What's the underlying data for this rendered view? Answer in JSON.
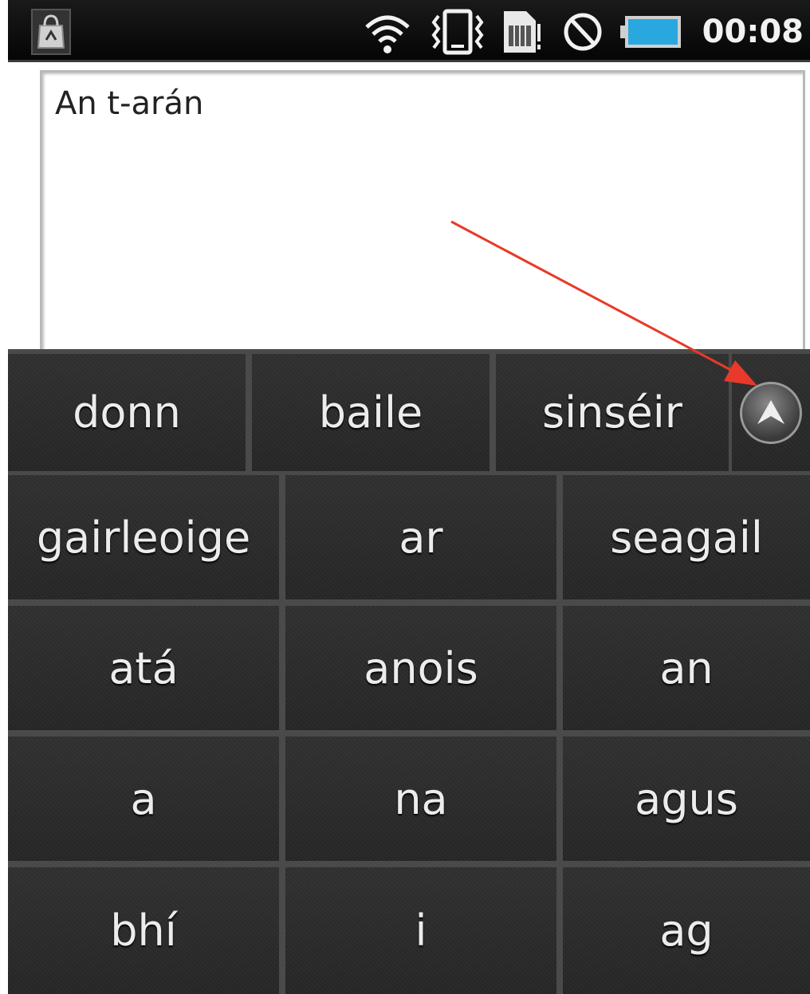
{
  "status_bar": {
    "time": "00:08",
    "icons": [
      "shopping-bag-icon",
      "wifi-icon",
      "vibrate-icon",
      "sim-card-icon",
      "no-signal-icon",
      "battery-icon"
    ],
    "battery_color": "#29a8e0"
  },
  "text_field": {
    "value": "An t-arán"
  },
  "suggestions": {
    "items": [
      "donn",
      "baile",
      "sinséir"
    ],
    "scroll_icon": "chevron-up-icon"
  },
  "keys": {
    "rows": [
      [
        "gairleoige",
        "ar",
        "seagail"
      ],
      [
        "atá",
        "anois",
        "an"
      ],
      [
        "a",
        "na",
        "agus"
      ],
      [
        "bhí",
        "i",
        "ag"
      ]
    ]
  },
  "annotation": {
    "arrow_color": "#e8392a"
  }
}
